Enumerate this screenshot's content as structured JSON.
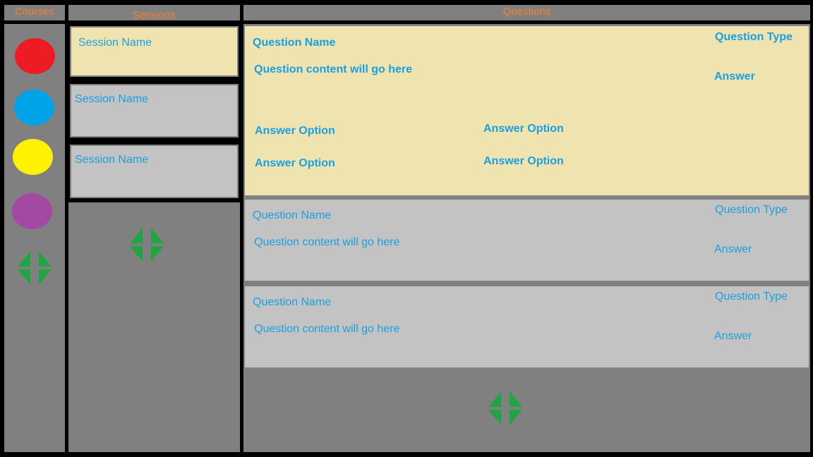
{
  "headers": {
    "courses": "Courses",
    "sessions": "Sessions",
    "questions": "Questions"
  },
  "colors": {
    "background": "#000000",
    "panel": "#808080",
    "header_text": "#f4802a",
    "selected_card": "#efe4b0",
    "card": "#c3c3c3",
    "card_text": "#1aa0e0",
    "add_icon": "#1fa642"
  },
  "courses": [
    {
      "color": "#ed1c24"
    },
    {
      "color": "#00a2e8"
    },
    {
      "color": "#fff200"
    },
    {
      "color": "#a349a4"
    }
  ],
  "sessions": [
    {
      "label": "Session Name",
      "selected": true
    },
    {
      "label": "Session Name",
      "selected": false
    },
    {
      "label": "Session Name",
      "selected": false
    }
  ],
  "questions": [
    {
      "name": "Question Name",
      "type": "Question Type",
      "content": "Question content will go here",
      "answer": "Answer",
      "selected": true,
      "options": [
        "Answer Option",
        "Answer Option",
        "Answer Option",
        "Answer Option"
      ]
    },
    {
      "name": "Question Name",
      "type": "Question Type",
      "content": "Question content will go here",
      "answer": "Answer",
      "selected": false
    },
    {
      "name": "Question Name",
      "type": "Question Type",
      "content": "Question content will go here",
      "answer": "Answer",
      "selected": false
    }
  ],
  "icons": {
    "add_course": "add-icon",
    "add_session": "add-icon",
    "add_question": "add-icon"
  }
}
